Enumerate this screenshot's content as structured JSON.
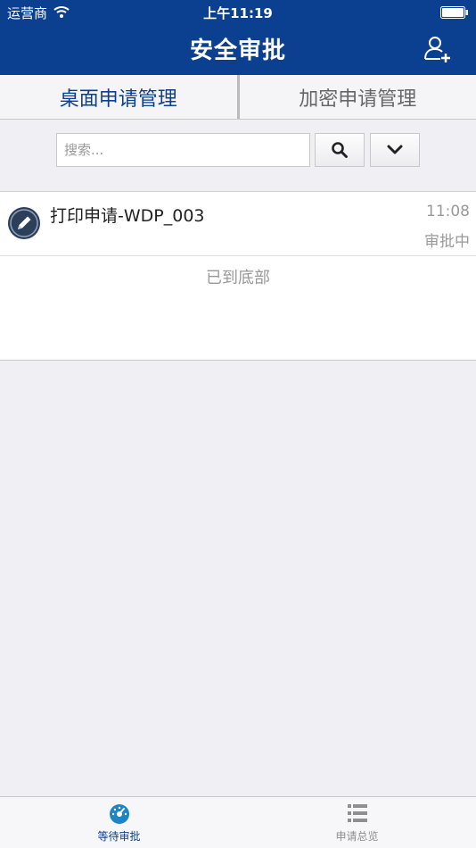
{
  "status_bar": {
    "carrier": "运营商",
    "time": "上午11:19"
  },
  "nav": {
    "title": "安全审批",
    "add_user_icon": "add-user-icon"
  },
  "segments": [
    {
      "label": "桌面申请管理",
      "active": true
    },
    {
      "label": "加密申请管理",
      "active": false
    }
  ],
  "search": {
    "placeholder": "搜索...",
    "value": "",
    "search_icon": "search-icon",
    "dropdown_icon": "chevron-down-icon"
  },
  "list": {
    "items": [
      {
        "title": "打印申请-WDP_003",
        "time": "11:08",
        "status": "审批中",
        "icon": "edit-icon"
      }
    ],
    "end_text": "已到底部"
  },
  "tab_bar": [
    {
      "label": "等待审批",
      "icon": "dashboard-icon",
      "active": true
    },
    {
      "label": "申请总览",
      "icon": "list-icon",
      "active": false
    }
  ],
  "colors": {
    "primary": "#0b3f8f",
    "background": "#efeff4",
    "muted": "#999999"
  }
}
